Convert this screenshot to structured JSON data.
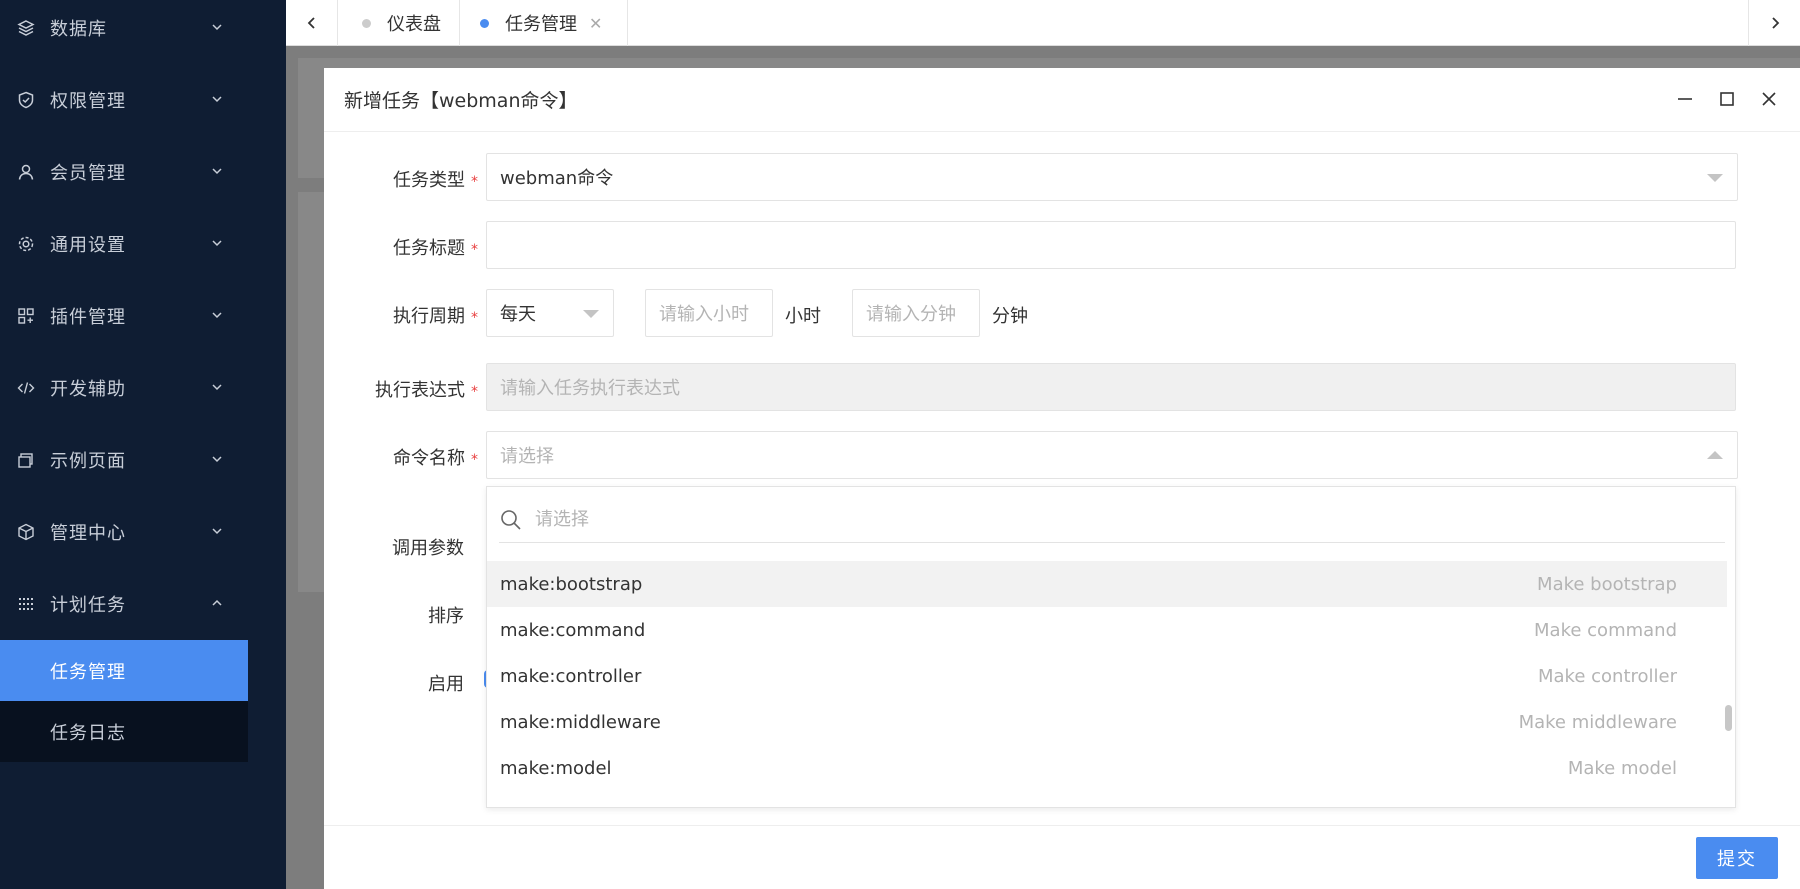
{
  "sidebar": {
    "items": [
      {
        "label": "数据库",
        "icon": "database-icon"
      },
      {
        "label": "权限管理",
        "icon": "shield-icon"
      },
      {
        "label": "会员管理",
        "icon": "user-icon"
      },
      {
        "label": "通用设置",
        "icon": "gear-icon"
      },
      {
        "label": "插件管理",
        "icon": "plugin-icon"
      },
      {
        "label": "开发辅助",
        "icon": "code-icon"
      },
      {
        "label": "示例页面",
        "icon": "page-icon"
      },
      {
        "label": "管理中心",
        "icon": "cube-icon"
      },
      {
        "label": "计划任务",
        "icon": "grid-icon"
      }
    ],
    "submenu": [
      {
        "label": "任务管理",
        "active": true
      },
      {
        "label": "任务日志",
        "active": false
      }
    ],
    "accent": "#4a8cf0",
    "bg": "#0f1d33"
  },
  "tabs": [
    {
      "label": "仪表盘",
      "dot_color": "#cccccc"
    },
    {
      "label": "任务管理",
      "dot_color": "#4a8cf0",
      "close": "✕"
    }
  ],
  "modal": {
    "title": "新增任务【webman命令】",
    "fields": {
      "task_type": {
        "label": "任务类型",
        "value": "webman命令"
      },
      "task_title": {
        "label": "任务标题",
        "value": ""
      },
      "cycle": {
        "label": "执行周期",
        "value": "每天",
        "hour_placeholder": "请输入小时",
        "hour_unit": "小时",
        "minute_placeholder": "请输入分钟",
        "minute_unit": "分钟"
      },
      "expression": {
        "label": "执行表达式",
        "placeholder": "请输入任务执行表达式"
      },
      "command": {
        "label": "命令名称",
        "placeholder": "请选择"
      },
      "params": {
        "label": "调用参数"
      },
      "sort": {
        "label": "排序"
      },
      "enable": {
        "label": "启用"
      }
    },
    "required_mark": "*",
    "dropdown": {
      "search_placeholder": "请选择",
      "options": [
        {
          "value": "make:bootstrap",
          "desc": "Make bootstrap"
        },
        {
          "value": "make:command",
          "desc": "Make command"
        },
        {
          "value": "make:controller",
          "desc": "Make controller"
        },
        {
          "value": "make:middleware",
          "desc": "Make middleware"
        },
        {
          "value": "make:model",
          "desc": "Make model"
        }
      ]
    },
    "submit_label": "提交"
  }
}
